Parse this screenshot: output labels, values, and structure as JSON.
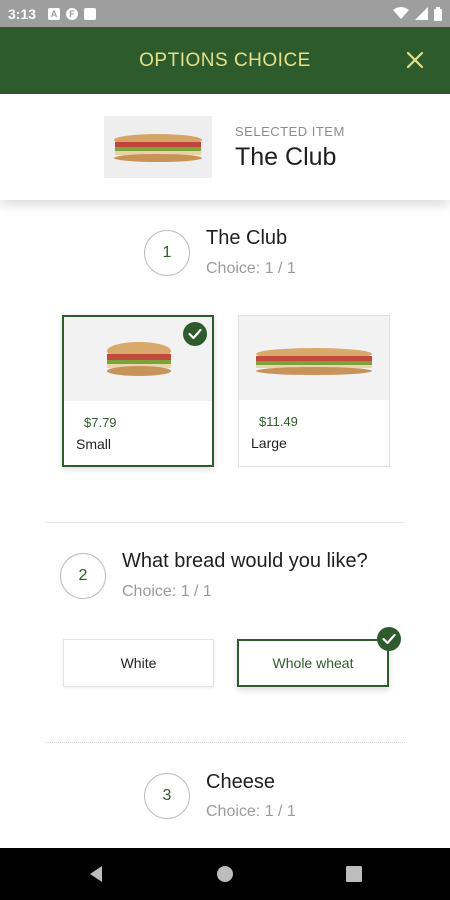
{
  "status_bar": {
    "time": "3:13",
    "notif_icons": [
      "A",
      "F"
    ]
  },
  "header": {
    "title": "OPTIONS CHOICE"
  },
  "selected_item": {
    "label": "SELECTED ITEM",
    "name": "The Club"
  },
  "steps": [
    {
      "number": "1",
      "title": "The Club",
      "choice": "Choice: 1 / 1",
      "options": [
        {
          "price": "$7.79",
          "label": "Small",
          "selected": true
        },
        {
          "price": "$11.49",
          "label": "Large",
          "selected": false
        }
      ]
    },
    {
      "number": "2",
      "title": "What bread would you like?",
      "choice": "Choice: 1 / 1",
      "options": [
        {
          "label": "White",
          "selected": false
        },
        {
          "label": "Whole wheat",
          "selected": true
        }
      ]
    },
    {
      "number": "3",
      "title": "Cheese",
      "choice": "Choice: 1 / 1"
    }
  ],
  "colors": {
    "brand_green": "#2e5b2b",
    "header_text": "#e6e08a"
  }
}
